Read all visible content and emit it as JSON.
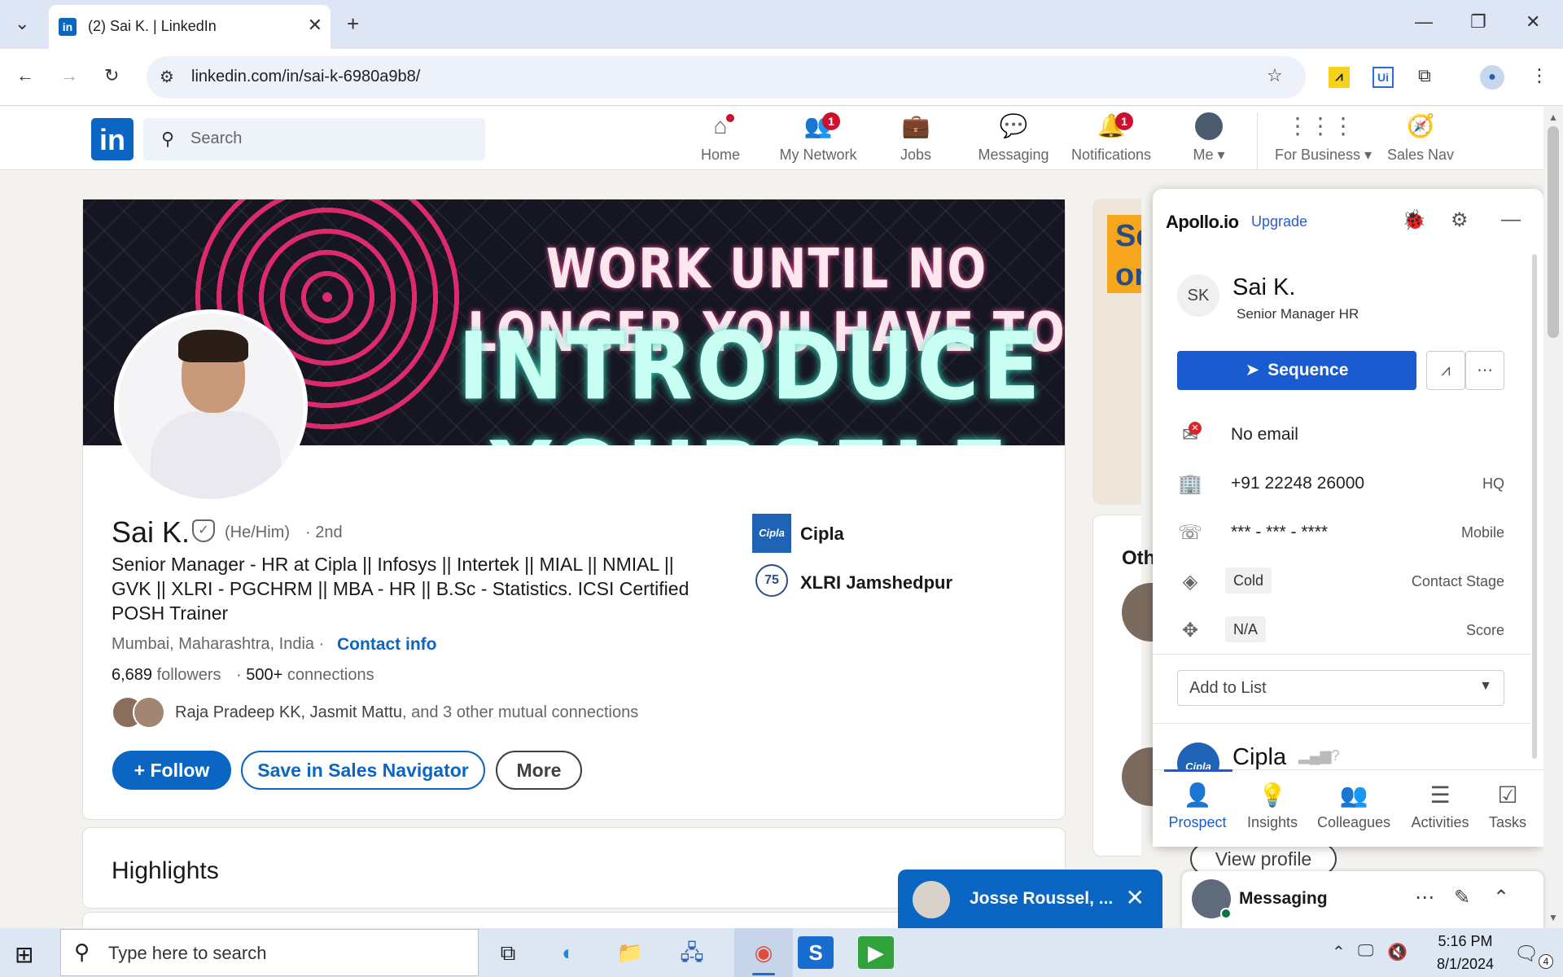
{
  "browser": {
    "tab_title": "(2) Sai K. | LinkedIn",
    "url": "linkedin.com/in/sai-k-6980a9b8/"
  },
  "linkedin_nav": {
    "search_placeholder": "Search",
    "items": [
      {
        "label": "Home",
        "icon": "home-icon",
        "badge": ""
      },
      {
        "label": "My Network",
        "icon": "people-icon",
        "badge": "1"
      },
      {
        "label": "Jobs",
        "icon": "briefcase-icon",
        "badge": ""
      },
      {
        "label": "Messaging",
        "icon": "chat-icon",
        "badge": ""
      },
      {
        "label": "Notifications",
        "icon": "bell-icon",
        "badge": "1"
      },
      {
        "label": "Me",
        "icon": "avatar",
        "badge": ""
      },
      {
        "label": "For Business",
        "icon": "grid-icon",
        "badge": ""
      },
      {
        "label": "Sales Nav",
        "icon": "compass-icon",
        "badge": ""
      }
    ]
  },
  "banner": {
    "line1": "WORK UNTIL NO LONGER YOU HAVE TO",
    "line2": "INTRODUCE YOURSELF"
  },
  "profile": {
    "name": "Sai K.",
    "pronouns": "(He/Him)",
    "degree": "· 2nd",
    "headline": "Senior Manager - HR at Cipla || Infosys || Intertek || MIAL || NMIAL || GVK || XLRI - PGCHRM || MBA - HR || B.Sc - Statistics. ICSI Certified POSH Trainer",
    "location": "Mumbai, Maharashtra, India ·",
    "contact_info": "Contact info",
    "followers_count": "6,689",
    "followers_label": "followers",
    "connections_count": "500+",
    "connections_label": "connections",
    "mutual_names": "Raja Pradeep KK, Jasmit Mattu",
    "mutual_rest": ", and 3 other mutual connections",
    "follow_label": "Follow",
    "save_label": "Save in Sales Navigator",
    "more_label": "More",
    "company": "Cipla",
    "company_logo_text": "Cipla",
    "school": "XLRI Jamshedpur",
    "school_logo_text": "75"
  },
  "highlights_title": "Highlights",
  "right_column": {
    "ad_text": "Se on",
    "others_title": "Oth",
    "view_profile": "View profile"
  },
  "apollo": {
    "logo": "Apollo.io",
    "upgrade": "Upgrade",
    "initials": "SK",
    "name": "Sai K.",
    "title": "Senior Manager HR",
    "sequence_label": "Sequence",
    "email": "No email",
    "phone": "+91 22248 26000",
    "phone_tag": "HQ",
    "mobile": "*** - *** - ****",
    "mobile_tag": "Mobile",
    "stage": "Cold",
    "stage_label": "Contact Stage",
    "score": "N/A",
    "score_label": "Score",
    "add_to_list": "Add to List",
    "company_name": "Cipla",
    "company_logo_text": "Cipla",
    "tabs": [
      "Prospect",
      "Insights",
      "Colleagues",
      "Activities",
      "Tasks"
    ]
  },
  "messaging": {
    "chat_name": "Josse Roussel, ...",
    "bar_title": "Messaging"
  },
  "taskbar": {
    "search_placeholder": "Type here to search",
    "time": "5:16 PM",
    "date": "8/1/2024",
    "notifications_count": "4"
  },
  "colors": {
    "linkedin_blue": "#0a66c2",
    "apollo_blue": "#1a5ccf",
    "badge_red": "#cb112d"
  }
}
